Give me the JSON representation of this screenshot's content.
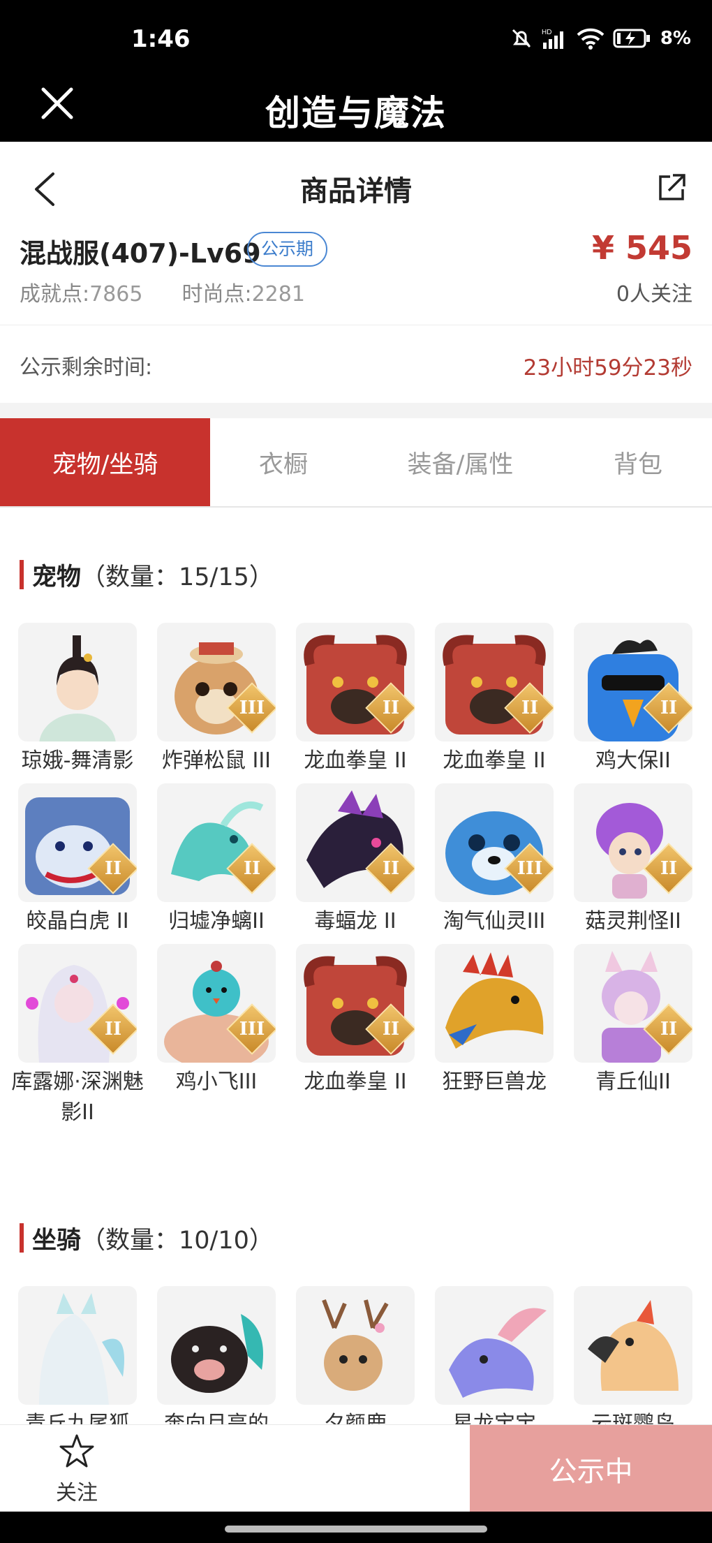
{
  "status": {
    "time": "1:46",
    "battery": "8%"
  },
  "app": {
    "title": "创造与魔法"
  },
  "page": {
    "title": "商品详情"
  },
  "product": {
    "server": "混战服(407)-Lv69",
    "badge": "公示期",
    "achievement_label": "成就点:",
    "achievement_value": "7865",
    "fashion_label": "时尚点:",
    "fashion_value": "2281",
    "price": "¥ 545",
    "followers": "0人关注",
    "remain_label": "公示剩余时间:",
    "remain_value": "23小时59分23秒"
  },
  "tabs": [
    "宠物/坐骑",
    "衣橱",
    "装备/属性",
    "背包"
  ],
  "pets": {
    "title": "宠物",
    "count": "（数量：15/15）",
    "items": [
      {
        "name": "琼娥-舞清影",
        "tier": ""
      },
      {
        "name": "炸弹松鼠 III",
        "tier": "III"
      },
      {
        "name": "龙血拳皇 II",
        "tier": "II"
      },
      {
        "name": "龙血拳皇 II",
        "tier": "II"
      },
      {
        "name": "鸡大保II",
        "tier": "II"
      },
      {
        "name": "皎晶白虎 II",
        "tier": "II"
      },
      {
        "name": "归墟净螭II",
        "tier": "II"
      },
      {
        "name": "毒蝠龙 II",
        "tier": "II"
      },
      {
        "name": "淘气仙灵III",
        "tier": "III"
      },
      {
        "name": "菇灵荆怪II",
        "tier": "II"
      },
      {
        "name": "库露娜·深渊魅影II",
        "tier": "II"
      },
      {
        "name": "鸡小飞III",
        "tier": "III"
      },
      {
        "name": "龙血拳皇 II",
        "tier": "II"
      },
      {
        "name": "狂野巨兽龙",
        "tier": ""
      },
      {
        "name": "青丘仙II",
        "tier": "II"
      }
    ]
  },
  "mounts": {
    "title": "坐骑",
    "count": "（数量：10/10）",
    "items": [
      {
        "name": "青丘九尾狐"
      },
      {
        "name": "奔向月亮的"
      },
      {
        "name": "夕颜鹿"
      },
      {
        "name": "星龙宝宝"
      },
      {
        "name": "云斑鹦鸟"
      }
    ]
  },
  "footer": {
    "follow_label": "关注",
    "action_label": "公示中"
  }
}
